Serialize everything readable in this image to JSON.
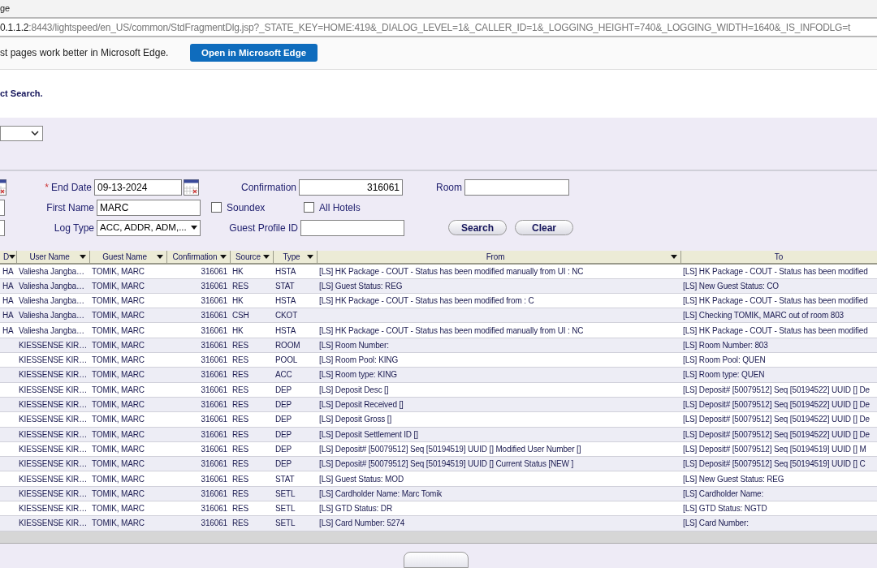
{
  "browser": {
    "title": "ge",
    "url_host": "0.1.1.2",
    "url_rest": ":8443/lightspeed/en_US/common/StdFragmentDlg.jsp?_STATE_KEY=HOME:419&_DIALOG_LEVEL=1&_CALLER_ID=1&_LOGGING_HEIGHT=740&_LOGGING_WIDTH=1640&_IS_INFODLG=t",
    "infobar": {
      "message": "st pages work better in Microsoft Edge.",
      "button": "Open in Microsoft Edge"
    }
  },
  "page": {
    "heading": "ct Search."
  },
  "filters": {
    "end_date": {
      "label": "End Date",
      "required_mark": "*",
      "value": "09-13-2024"
    },
    "first_name": {
      "label": "First Name",
      "value": "MARC"
    },
    "log_type": {
      "label": "Log Type",
      "value": "ACC, ADDR, ADM,..."
    },
    "confirmation": {
      "label": "Confirmation",
      "value": "316061"
    },
    "guest_profile_id": {
      "label": "Guest Profile ID"
    },
    "room": {
      "label": "Room"
    },
    "soundex": {
      "label": "Soundex",
      "checked": false
    },
    "all_hotels": {
      "label": "All Hotels",
      "checked": false
    },
    "buttons": [
      "Search",
      "Clear"
    ]
  },
  "table": {
    "columns": [
      "D",
      "User Name",
      "Guest Name",
      "Confirmation",
      "Source",
      "Type",
      "From",
      "To"
    ],
    "rows": [
      [
        "HA",
        "Valiesha Jangba…",
        "TOMIK, MARC",
        "316061",
        "HK",
        "HSTA",
        "[LS] HK Package - COUT - Status has been modified manually from UI : NC",
        "[LS] HK Package - COUT - Status has been modified"
      ],
      [
        "HA",
        "Valiesha Jangba…",
        "TOMIK, MARC",
        "316061",
        "RES",
        "STAT",
        "[LS] Guest Status: REG",
        "[LS] New Guest Status: CO"
      ],
      [
        "HA",
        "Valiesha Jangba…",
        "TOMIK, MARC",
        "316061",
        "HK",
        "HSTA",
        "[LS] HK Package - COUT - Status has been modified from : C",
        "[LS] HK Package - COUT - Status has been modified"
      ],
      [
        "HA",
        "Valiesha Jangba…",
        "TOMIK, MARC",
        "316061",
        "CSH",
        "CKOT",
        "",
        "[LS] Checking TOMIK, MARC out of room 803"
      ],
      [
        "HA",
        "Valiesha Jangba…",
        "TOMIK, MARC",
        "316061",
        "HK",
        "HSTA",
        "[LS] HK Package - COUT - Status has been modified manually from UI : NC",
        "[LS] HK Package - COUT - Status has been modified"
      ],
      [
        "",
        "KIESSENSE KIR…",
        "TOMIK, MARC",
        "316061",
        "RES",
        "ROOM",
        "[LS] Room Number:",
        "[LS] Room Number: 803"
      ],
      [
        "",
        "KIESSENSE KIR…",
        "TOMIK, MARC",
        "316061",
        "RES",
        "POOL",
        "[LS] Room Pool: KING",
        "[LS] Room Pool: QUEN"
      ],
      [
        "",
        "KIESSENSE KIR…",
        "TOMIK, MARC",
        "316061",
        "RES",
        "ACC",
        "[LS] Room type: KING",
        "[LS] Room type: QUEN"
      ],
      [
        "",
        "KIESSENSE KIR…",
        "TOMIK, MARC",
        "316061",
        "RES",
        "DEP",
        "[LS] Deposit Desc []",
        "[LS] Deposit# [50079512] Seq [50194522] UUID [] De"
      ],
      [
        "",
        "KIESSENSE KIR…",
        "TOMIK, MARC",
        "316061",
        "RES",
        "DEP",
        "[LS] Deposit Received []",
        "[LS] Deposit# [50079512] Seq [50194522] UUID [] De"
      ],
      [
        "",
        "KIESSENSE KIR…",
        "TOMIK, MARC",
        "316061",
        "RES",
        "DEP",
        "[LS] Deposit Gross []",
        "[LS] Deposit# [50079512] Seq [50194522] UUID [] De"
      ],
      [
        "",
        "KIESSENSE KIR…",
        "TOMIK, MARC",
        "316061",
        "RES",
        "DEP",
        "[LS] Deposit Settlement ID []",
        "[LS] Deposit# [50079512] Seq [50194522] UUID [] De"
      ],
      [
        "",
        "KIESSENSE KIR…",
        "TOMIK, MARC",
        "316061",
        "RES",
        "DEP",
        "[LS] Deposit# [50079512] Seq [50194519] UUID [] Modified User Number []",
        "[LS] Deposit# [50079512] Seq [50194519] UUID [] M"
      ],
      [
        "",
        "KIESSENSE KIR…",
        "TOMIK, MARC",
        "316061",
        "RES",
        "DEP",
        "[LS] Deposit# [50079512] Seq [50194519] UUID [] Current Status [NEW ]",
        "[LS] Deposit# [50079512] Seq [50194519] UUID [] C"
      ],
      [
        "",
        "KIESSENSE KIR…",
        "TOMIK, MARC",
        "316061",
        "RES",
        "STAT",
        "[LS] Guest Status: MOD",
        "[LS] New Guest Status: REG"
      ],
      [
        "",
        "KIESSENSE KIR…",
        "TOMIK, MARC",
        "316061",
        "RES",
        "SETL",
        "[LS] Cardholder Name: Marc Tomik",
        "[LS] Cardholder Name:"
      ],
      [
        "",
        "KIESSENSE KIR…",
        "TOMIK, MARC",
        "316061",
        "RES",
        "SETL",
        "[LS] GTD Status: DR",
        "[LS] GTD Status: NGTD"
      ],
      [
        "",
        "KIESSENSE KIR…",
        "TOMIK, MARC",
        "316061",
        "RES",
        "SETL",
        "[LS] Card Number: 5274",
        "[LS] Card Number:"
      ]
    ]
  }
}
